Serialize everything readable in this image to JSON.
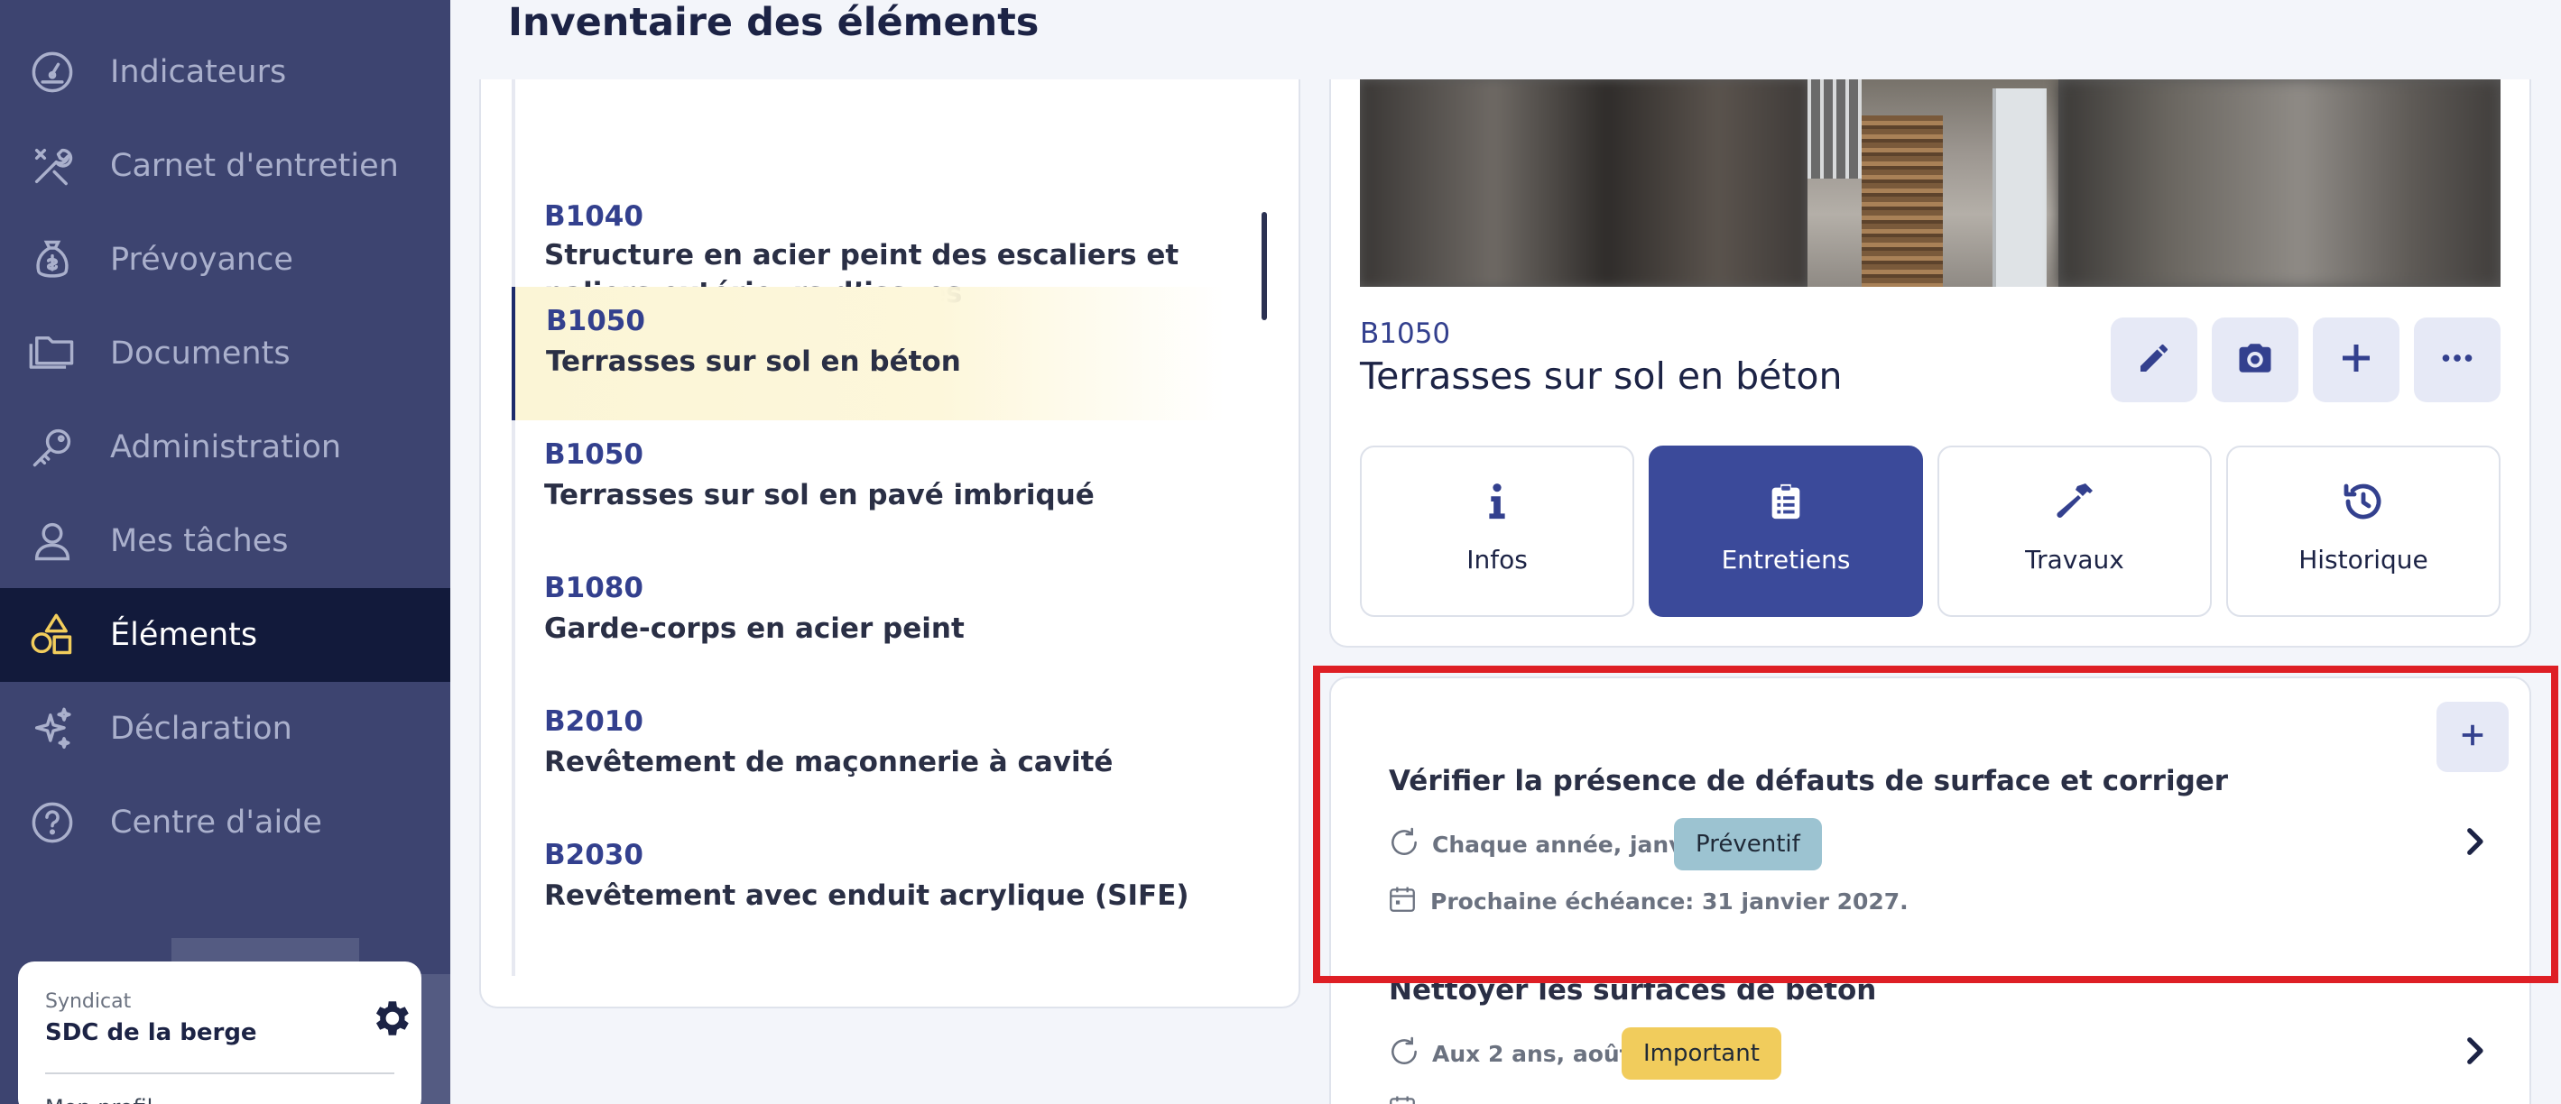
{
  "sidebar": {
    "items": [
      {
        "label": "Indicateurs",
        "icon": "gauge-icon"
      },
      {
        "label": "Carnet d'entretien",
        "icon": "tools-icon"
      },
      {
        "label": "Prévoyance",
        "icon": "money-bag-icon"
      },
      {
        "label": "Documents",
        "icon": "folders-icon"
      },
      {
        "label": "Administration",
        "icon": "key-icon"
      },
      {
        "label": "Mes tâches",
        "icon": "user-icon"
      },
      {
        "label": "Éléments",
        "icon": "shapes-icon",
        "active": true
      },
      {
        "label": "Déclaration",
        "icon": "sparkles-icon"
      },
      {
        "label": "Centre d'aide",
        "icon": "help-circle-icon"
      }
    ],
    "syndicat": {
      "caption": "Syndicat",
      "name": "SDC de la berge",
      "next_label": "Mon profil"
    }
  },
  "page": {
    "title": "Inventaire des éléments"
  },
  "inventory_list": [
    {
      "code": "B1040",
      "title": "Structure en acier peint des escaliers et paliers extérieurs d’issues"
    },
    {
      "code": "B1050",
      "title": "Terrasses sur sol en béton",
      "selected": true
    },
    {
      "code": "B1050",
      "title": "Terrasses sur sol en pavé imbriqué"
    },
    {
      "code": "B1080",
      "title": "Garde-corps en acier peint"
    },
    {
      "code": "B2010",
      "title": "Revêtement de maçonnerie à cavité"
    },
    {
      "code": "B2030",
      "title": "Revêtement avec enduit acrylique (SIFE)"
    }
  ],
  "detail": {
    "code": "B1050",
    "title": "Terrasses sur sol en béton",
    "actions": [
      "edit-icon",
      "camera-icon",
      "plus-icon",
      "more-icon"
    ],
    "tabs": [
      {
        "label": "Infos",
        "icon": "info-icon"
      },
      {
        "label": "Entretiens",
        "icon": "clipboard-icon",
        "active": true
      },
      {
        "label": "Travaux",
        "icon": "hammer-icon"
      },
      {
        "label": "Historique",
        "icon": "history-icon"
      }
    ]
  },
  "tasks": [
    {
      "title": "Vérifier la présence de défauts de surface et corriger",
      "frequency": "Chaque année, janv.",
      "badge": "Préventif",
      "badge_color": "#9cc3d1",
      "due": "Prochaine échéance: 31 janvier 2027."
    },
    {
      "title": "Nettoyer les surfaces de béton",
      "frequency": "Aux 2 ans, août",
      "badge": "Important",
      "badge_color": "#f1cc5c",
      "due": ""
    }
  ],
  "colors": {
    "sidebar_bg": "#3d4470",
    "sidebar_active": "#121a3b",
    "accent": "#3b4a9a",
    "highlight": "#de1f25"
  }
}
